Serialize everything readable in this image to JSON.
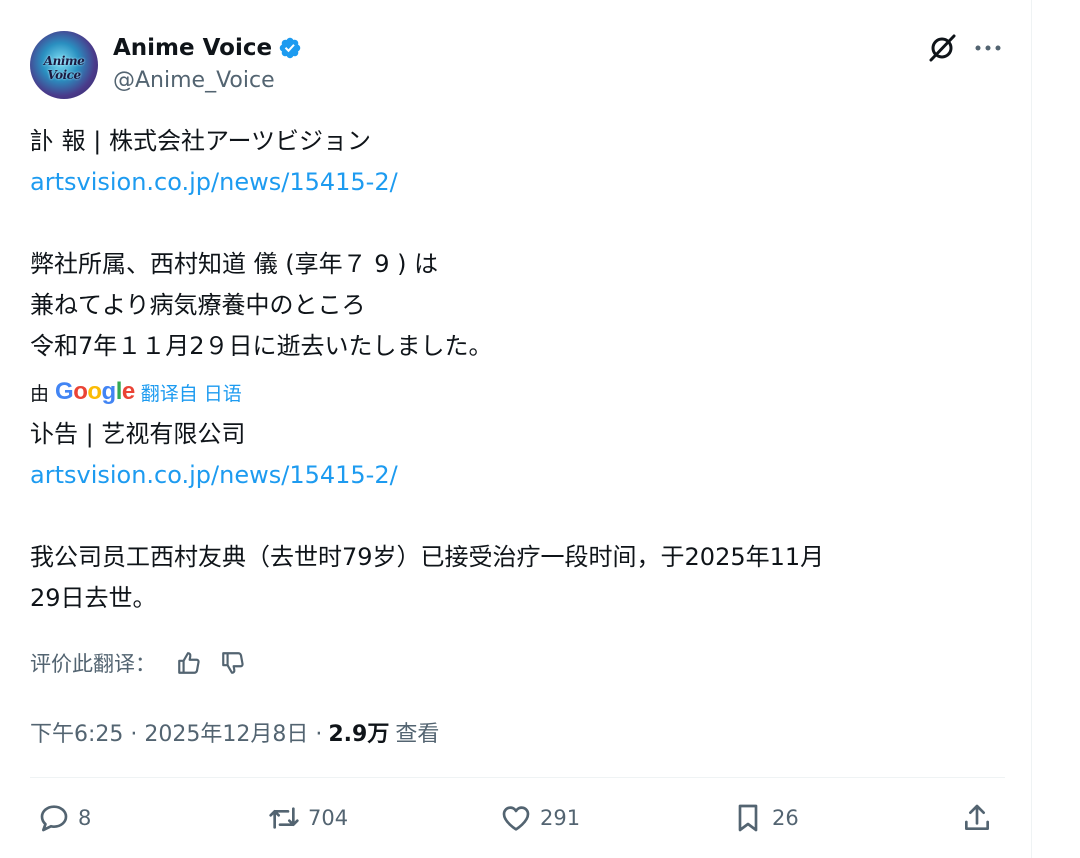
{
  "author": {
    "display_name": "Anime Voice",
    "handle": "@Anime_Voice",
    "avatar_text": "Anime Voice",
    "verified": true
  },
  "original": {
    "lines": [
      "訃 報 | 株式会社アーツビジョン",
      "artsvision.co.jp/news/15415-2/",
      "",
      "弊社所属、西村知道 儀 (享年７ 9 ) は",
      "兼ねてより病気療養中のところ",
      "令和7年１１月2９日に逝去いたしました。"
    ]
  },
  "translation_note": {
    "by": "由",
    "google": [
      "G",
      "o",
      "o",
      "g",
      "l",
      "e"
    ],
    "from": "翻译自 日语"
  },
  "translation": {
    "lines": [
      "讣告 | 艺视有限公司",
      "artsvision.co.jp/news/15415-2/",
      "",
      "我公司员工西村友典（去世时79岁）已接受治疗一段时间，于2025年11月",
      "29日去世。"
    ]
  },
  "rating": {
    "label": "评价此翻译："
  },
  "meta": {
    "time": "下午6:25 · 2025年12月8日 ·",
    "views": "2.9万",
    "views_label": "查看"
  },
  "actions": {
    "replies": "8",
    "retweets": "704",
    "likes": "291",
    "bookmarks": "26"
  },
  "colors": {
    "link": "#1d9bf0",
    "secondary_text": "#536471",
    "google": [
      "#4285f4",
      "#ea4335",
      "#fbbc05",
      "#4285f4",
      "#34a853",
      "#ea4335"
    ]
  },
  "icons": [
    "verified-badge-icon",
    "grok-icon",
    "more-icon",
    "thumbs-up-icon",
    "thumbs-down-icon",
    "reply-icon",
    "retweet-icon",
    "like-icon",
    "bookmark-icon",
    "share-icon"
  ]
}
